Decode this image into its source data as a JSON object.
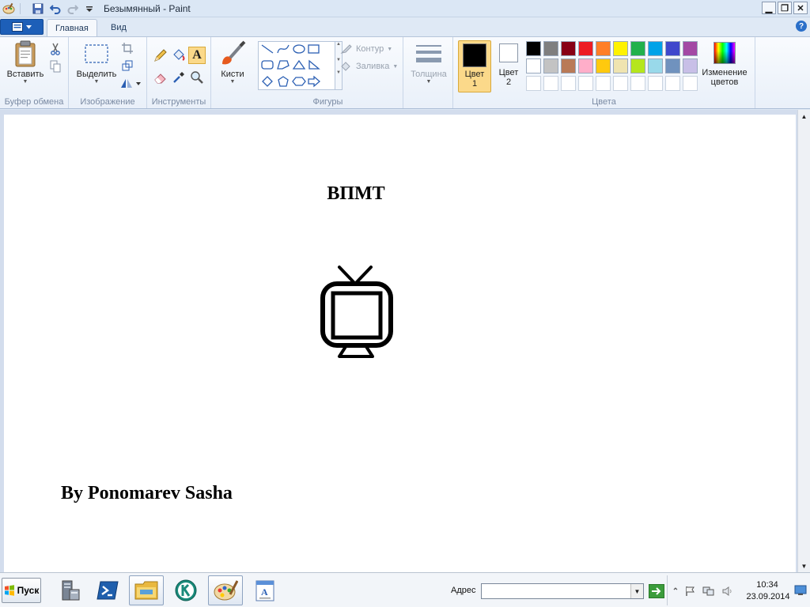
{
  "window": {
    "title": "Безымянный - Paint",
    "minimize_glyph": "▁",
    "restore_glyph": "❐",
    "close_glyph": "✕"
  },
  "tabs": {
    "home": "Главная",
    "view": "Вид",
    "help_glyph": "?"
  },
  "ribbon": {
    "clipboard": {
      "paste": "Вставить",
      "label": "Буфер обмена"
    },
    "image": {
      "select": "Выделить",
      "label": "Изображение"
    },
    "tools": {
      "label": "Инструменты",
      "text_tool_glyph": "A"
    },
    "brushes": {
      "label": "Кисти"
    },
    "shapes": {
      "label": "Фигуры",
      "outline": "Контур",
      "fill": "Заливка"
    },
    "thickness": {
      "label": "Толщина"
    },
    "colors": {
      "label": "Цвета",
      "color1_line1": "Цвет",
      "color1_line2": "1",
      "color2_line1": "Цвет",
      "color2_line2": "2",
      "edit_colors_line1": "Изменение",
      "edit_colors_line2": "цветов",
      "color1_value": "#000000",
      "color2_value": "#ffffff",
      "palette_row1": [
        "#000000",
        "#7f7f7f",
        "#880015",
        "#ed1c24",
        "#ff7f27",
        "#fff200",
        "#22b14c",
        "#00a2e8",
        "#3f48cc",
        "#a349a4"
      ],
      "palette_row2": [
        "#ffffff",
        "#c3c3c3",
        "#b97a57",
        "#ffaec9",
        "#ffc90e",
        "#efe4b0",
        "#b5e61d",
        "#99d9ea",
        "#7092be",
        "#c8bfe7"
      ]
    }
  },
  "canvas": {
    "title": "ВПМТ",
    "author": "By Ponomarev Sasha",
    "drawing": "tv-icon"
  },
  "taskbar": {
    "start": "Пуск",
    "address_label": "Адрес",
    "address_value": "",
    "time": "10:34",
    "date": "23.09.2014"
  }
}
